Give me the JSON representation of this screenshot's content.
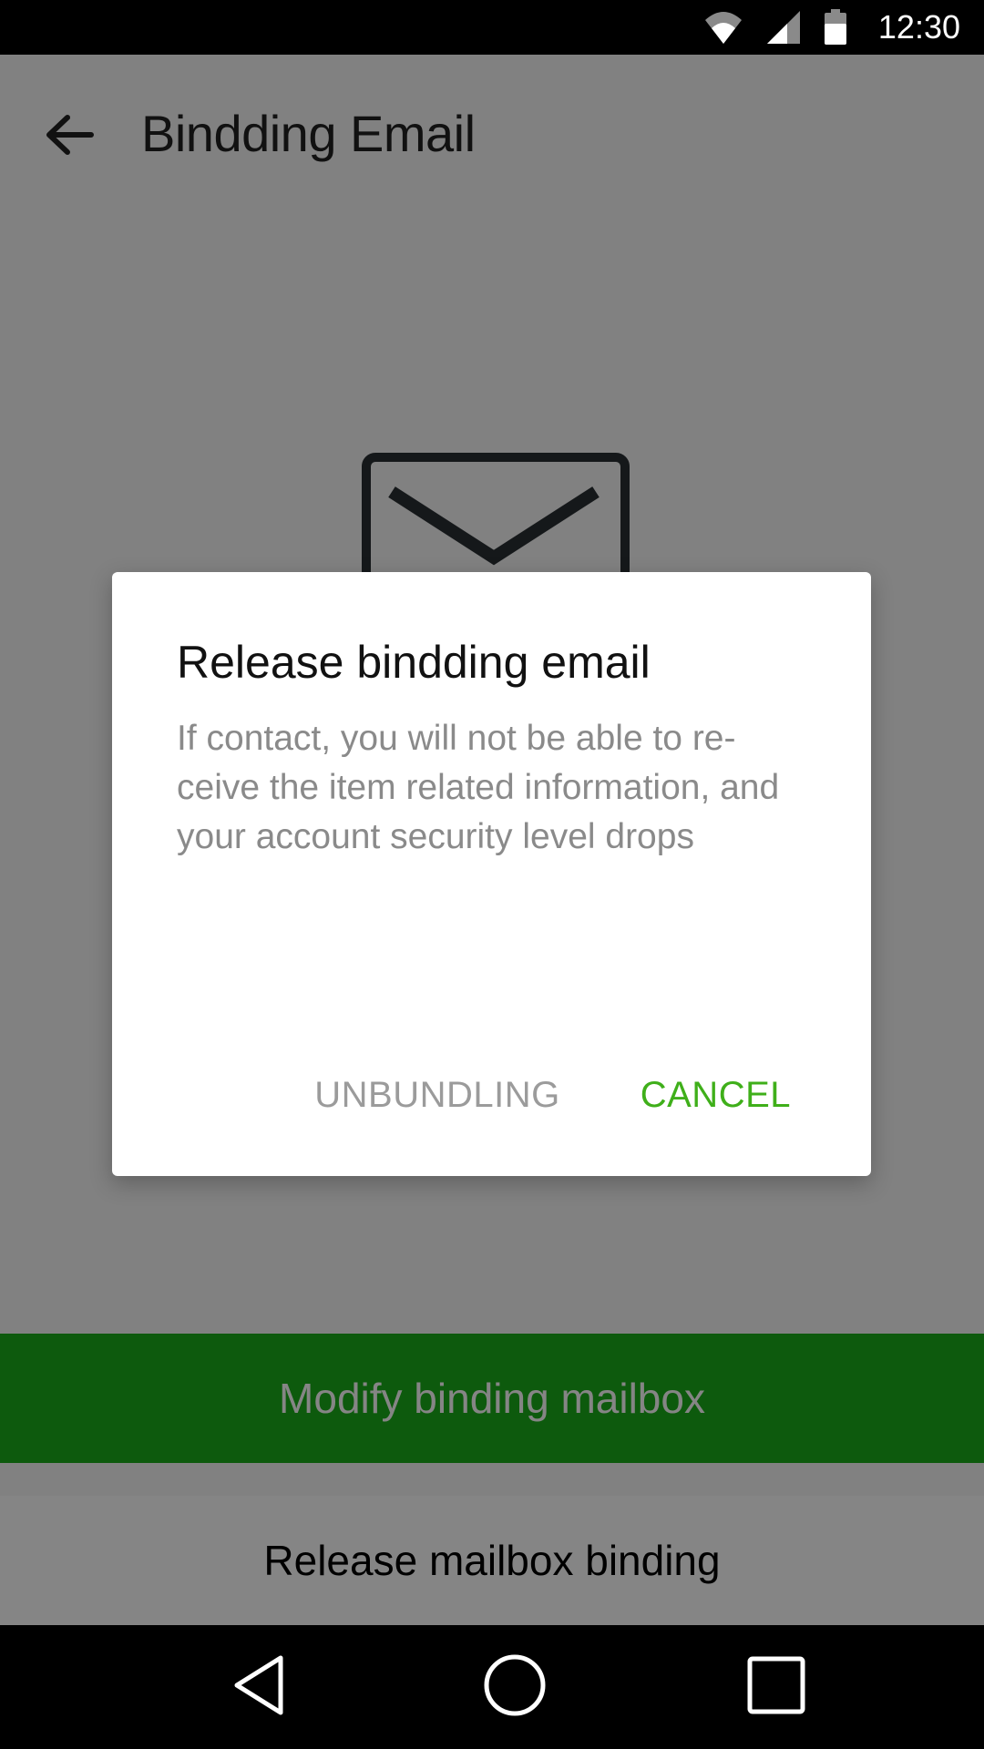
{
  "status_bar": {
    "time": "12:30",
    "icons": [
      "wifi-icon",
      "cell-signal-icon",
      "battery-icon"
    ]
  },
  "app_bar": {
    "title": "Bindding Email",
    "back_icon": "arrow-back-icon"
  },
  "content": {
    "illustration_icon": "mail-check-icon",
    "email_label": "",
    "modify_button": "Modify binding mailbox",
    "release_button": "Release mailbox binding"
  },
  "dialog": {
    "title": "Release bindding email",
    "message": "If contact, you will not be able to re-ceive the item related information, and your account security level drops",
    "actions": {
      "unbundling": "UNBUNDLING",
      "cancel": "CANCEL"
    }
  },
  "nav_bar": {
    "icons": [
      "nav-back-icon",
      "nav-home-icon",
      "nav-recents-icon"
    ]
  },
  "colors": {
    "accent_green": "#1aad19",
    "cancel_green": "#3faf1a",
    "scrim": "rgba(0,0,0,0.48)"
  }
}
